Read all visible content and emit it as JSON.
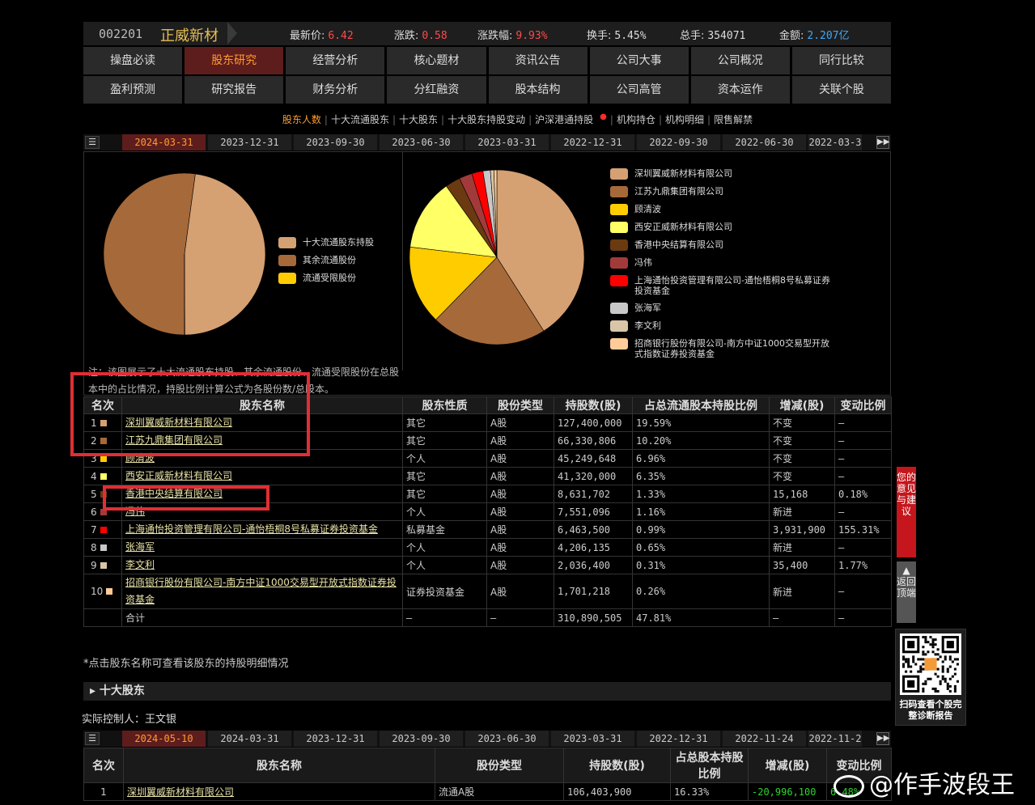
{
  "header": {
    "code": "002201",
    "name": "正威新材",
    "quotes": [
      {
        "label": "最新价:",
        "value": "6.42",
        "tone": "red"
      },
      {
        "label": "涨跌:",
        "value": "0.58",
        "tone": "red"
      },
      {
        "label": "涨跌幅:",
        "value": "9.93%",
        "tone": "red"
      },
      {
        "label": "换手:",
        "value": "5.45%",
        "tone": "white"
      },
      {
        "label": "总手:",
        "value": "354071",
        "tone": "white"
      },
      {
        "label": "金额:",
        "value": "2.207亿",
        "tone": "blue"
      }
    ]
  },
  "nav_row1": [
    "操盘必读",
    "股东研究",
    "经营分析",
    "核心题材",
    "资讯公告",
    "公司大事",
    "公司概况",
    "同行比较"
  ],
  "nav_row2": [
    "盈利预测",
    "研究报告",
    "财务分析",
    "分红融资",
    "股本结构",
    "公司高管",
    "资本运作",
    "关联个股"
  ],
  "nav_active": "股东研究",
  "subnav": [
    "股东人数",
    "十大流通股东",
    "十大股东",
    "十大股东持股变动",
    "沪深港通持股",
    "机构持仓",
    "机构明细",
    "限售解禁"
  ],
  "dates1": [
    "2024-03-31",
    "2023-12-31",
    "2023-09-30",
    "2023-06-30",
    "2023-03-31",
    "2022-12-31",
    "2022-09-30",
    "2022-06-30",
    "2022-03-3"
  ],
  "dates2": [
    "2024-05-10",
    "2024-03-31",
    "2023-12-31",
    "2023-09-30",
    "2023-06-30",
    "2023-03-31",
    "2022-12-31",
    "2022-11-24",
    "2022-11-2"
  ],
  "colors": {
    "c1": "#d5a072",
    "c2": "#a6693a",
    "c3": "#ffcc00",
    "c4": "#ffff66",
    "c5": "#6b3a10",
    "c6": "#a33a3a",
    "c7": "#ff0000",
    "c8": "#c8c8c8",
    "c9": "#d8c6a8",
    "c10": "#ffcc99"
  },
  "pie1_legend": [
    "十大流通股东持股",
    "其余流通股份",
    "流通受限股份"
  ],
  "pie1_values": [
    47.81,
    52.14,
    0.05
  ],
  "note": "注：该图展示了十大流通股东持股、其余流通股份、流通受限股份在总股本中的占比情况，持股比例计算公式为各股份数/总股本。",
  "table1": {
    "headers": [
      "名次",
      "股东名称",
      "股东性质",
      "股份类型",
      "持股数(股)",
      "占总流通股本持股比例",
      "增减(股)",
      "变动比例"
    ],
    "rows": [
      {
        "rank": "1",
        "name": "深圳翼威新材料有限公司",
        "nature": "其它",
        "type": "A股",
        "shares": "127,400,000",
        "pct": "19.59%",
        "change": "不变",
        "ratio": "—"
      },
      {
        "rank": "2",
        "name": "江苏九鼎集团有限公司",
        "nature": "其它",
        "type": "A股",
        "shares": "66,330,806",
        "pct": "10.20%",
        "change": "不变",
        "ratio": "—"
      },
      {
        "rank": "3",
        "name": "顾清波",
        "nature": "个人",
        "type": "A股",
        "shares": "45,249,648",
        "pct": "6.96%",
        "change": "不变",
        "ratio": "—"
      },
      {
        "rank": "4",
        "name": "西安正威新材料有限公司",
        "nature": "其它",
        "type": "A股",
        "shares": "41,320,000",
        "pct": "6.35%",
        "change": "不变",
        "ratio": "—"
      },
      {
        "rank": "5",
        "name": "香港中央结算有限公司",
        "nature": "其它",
        "type": "A股",
        "shares": "8,631,702",
        "pct": "1.33%",
        "change": "15,168",
        "ratio": "0.18%"
      },
      {
        "rank": "6",
        "name": "冯伟",
        "nature": "个人",
        "type": "A股",
        "shares": "7,551,096",
        "pct": "1.16%",
        "change": "新进",
        "ratio": "—"
      },
      {
        "rank": "7",
        "name": "上海通怡投资管理有限公司-通怡梧桐8号私募证券投资基金",
        "nature": "私募基金",
        "type": "A股",
        "shares": "6,463,500",
        "pct": "0.99%",
        "change": "3,931,900",
        "ratio": "155.31%"
      },
      {
        "rank": "8",
        "name": "张海军",
        "nature": "个人",
        "type": "A股",
        "shares": "4,206,135",
        "pct": "0.65%",
        "change": "新进",
        "ratio": "—"
      },
      {
        "rank": "9",
        "name": "李文利",
        "nature": "个人",
        "type": "A股",
        "shares": "2,036,400",
        "pct": "0.31%",
        "change": "35,400",
        "ratio": "1.77%"
      },
      {
        "rank": "10",
        "name": "招商银行股份有限公司-南方中证1000交易型开放式指数证券投资基金",
        "nature": "证券投资基金",
        "type": "A股",
        "shares": "1,701,218",
        "pct": "0.26%",
        "change": "新进",
        "ratio": "—"
      }
    ],
    "total": {
      "label": "合计",
      "nature": "—",
      "type": "—",
      "shares": "310,890,505",
      "pct": "47.81%",
      "change": "—",
      "ratio": "—"
    }
  },
  "pie2_legend": [
    "深圳翼威新材料有限公司",
    "江苏九鼎集团有限公司",
    "顾清波",
    "西安正威新材料有限公司",
    "香港中央结算有限公司",
    "冯伟",
    "上海通怡投资管理有限公司-通怡梧桐8号私募证券投资基金",
    "张海军",
    "李文利",
    "招商银行股份有限公司-南方中证1000交易型开放式指数证券投资基金"
  ],
  "pie2_values": [
    19.59,
    10.2,
    6.96,
    6.35,
    1.33,
    1.16,
    0.99,
    0.65,
    0.31,
    0.26
  ],
  "footnote": "*点击股东名称可查看该股东的持股明细情况",
  "section": "十大股东",
  "controller": "实际控制人：王文银",
  "table2": {
    "headers": [
      "名次",
      "股东名称",
      "股份类型",
      "持股数(股)",
      "占总股本持股比例",
      "增减(股)",
      "变动比例"
    ],
    "row": {
      "rank": "1",
      "name": "深圳翼威新材料有限公司",
      "type": "流通A股",
      "shares": "106,403,900",
      "pct": "16.33%",
      "change": "-20,996,100",
      "ratio": "6.48%"
    }
  },
  "side": {
    "feedback": "您的意见与建议",
    "top": "返回顶端",
    "qr": "扫码查看个股完整诊断报告"
  },
  "watermark": "@作手波段王"
}
